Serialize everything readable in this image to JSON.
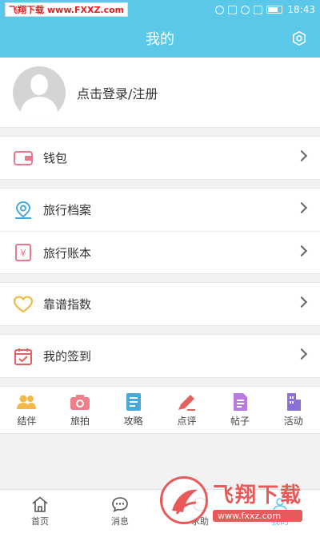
{
  "statusbar": {
    "watermark_a": "飞翔下载",
    "watermark_b": "www.FXXZ.com",
    "time": "18:43"
  },
  "header": {
    "title": "我的"
  },
  "profile": {
    "login_label": "点击登录/注册"
  },
  "menu_groups": [
    {
      "items": [
        {
          "label": "钱包",
          "icon": "wallet-icon"
        }
      ]
    },
    {
      "items": [
        {
          "label": "旅行档案",
          "icon": "location-pin-icon"
        },
        {
          "label": "旅行账本",
          "icon": "yuan-ledger-icon"
        }
      ]
    },
    {
      "items": [
        {
          "label": "靠谱指数",
          "icon": "heart-icon"
        }
      ]
    },
    {
      "items": [
        {
          "label": "我的签到",
          "icon": "calendar-check-icon"
        }
      ]
    }
  ],
  "shortcuts": [
    {
      "label": "结伴",
      "icon": "people-icon"
    },
    {
      "label": "旅拍",
      "icon": "camera-icon"
    },
    {
      "label": "攻略",
      "icon": "document-icon"
    },
    {
      "label": "点评",
      "icon": "pen-icon"
    },
    {
      "label": "帖子",
      "icon": "note-icon"
    },
    {
      "label": "活动",
      "icon": "building-icon"
    }
  ],
  "tabbar": [
    {
      "label": "首页",
      "icon": "home-icon"
    },
    {
      "label": "消息",
      "icon": "message-icon"
    },
    {
      "label": "求助",
      "icon": "help-icon"
    },
    {
      "label": "我的",
      "icon": "user-icon"
    }
  ],
  "watermark": {
    "title": "飞翔下载",
    "url": "www.fxxz.com"
  },
  "colors": {
    "accent": "#5bc8ea"
  }
}
